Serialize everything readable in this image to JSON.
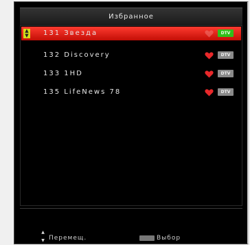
{
  "header": {
    "title": "Избранное"
  },
  "channels": [
    {
      "label": "131 Звезда",
      "badge": "DTV",
      "selected": true,
      "badge_color": "#2fbf1a"
    },
    {
      "label": "132 Discovery",
      "badge": "DTV",
      "selected": false,
      "badge_color": "#8a8a8a"
    },
    {
      "label": "133 1HD",
      "badge": "DTV",
      "selected": false,
      "badge_color": "#8a8a8a"
    },
    {
      "label": "135 LifeNews 78",
      "badge": "DTV",
      "selected": false,
      "badge_color": "#8a8a8a"
    }
  ],
  "footer": {
    "move_label": "Перемещ.",
    "move_icon": "up-down-arrows-icon",
    "select_label": "Выбор",
    "select_icon": "ok-key-icon"
  },
  "colors": {
    "selection": "#e0150d",
    "heart": "#e8282a",
    "background": "#000000"
  }
}
